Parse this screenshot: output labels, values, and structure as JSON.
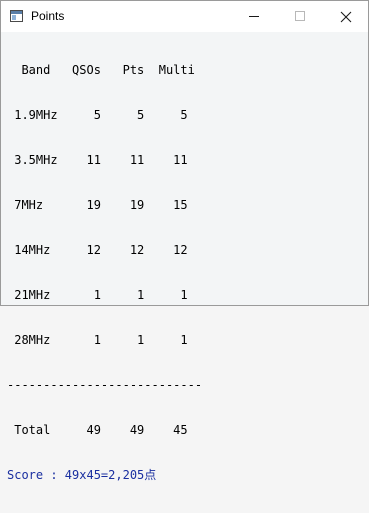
{
  "window": {
    "title": "Points"
  },
  "listing": {
    "header": "  Band   QSOs   Pts  Multi",
    "rows": [
      " 1.9MHz     5     5     5",
      " 3.5MHz    11    11    11",
      " 7MHz      19    19    15",
      " 14MHz     12    12    12",
      " 21MHz      1     1     1",
      " 28MHz      1     1     1"
    ],
    "separator": "---------------------------",
    "total": " Total     49    49    45",
    "score": "Score : 49x45=2,205点"
  },
  "colors": {
    "score_text": "#1a2fa0",
    "title_bar": "#ffffff",
    "client_bg": "#f3f5f6"
  },
  "icons": {
    "app": "app-window-icon",
    "minimize": "minimize-icon",
    "maximize": "maximize-icon",
    "close": "close-icon"
  }
}
